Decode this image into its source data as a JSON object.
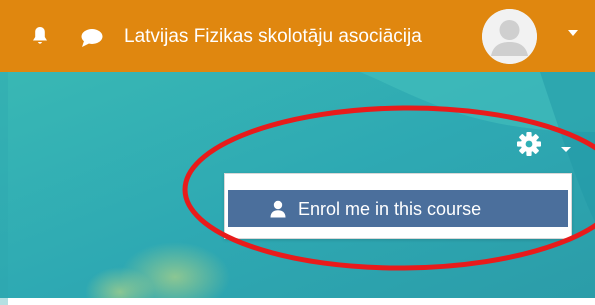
{
  "navbar": {
    "site_name": "Latvijas Fizikas skolotāju asociācija",
    "background_color": "#e0870f",
    "icons": [
      "bell-icon",
      "chat-icon",
      "user-avatar-icon",
      "caret-down-icon"
    ]
  },
  "course_menu": {
    "icon": "gear-icon",
    "enrol_label": "Enrol me in this course",
    "enrol_icon": "user-icon",
    "enrol_color": "#4b6f9c"
  },
  "annotation": {
    "shape": "ellipse",
    "color": "#e81b1b"
  }
}
